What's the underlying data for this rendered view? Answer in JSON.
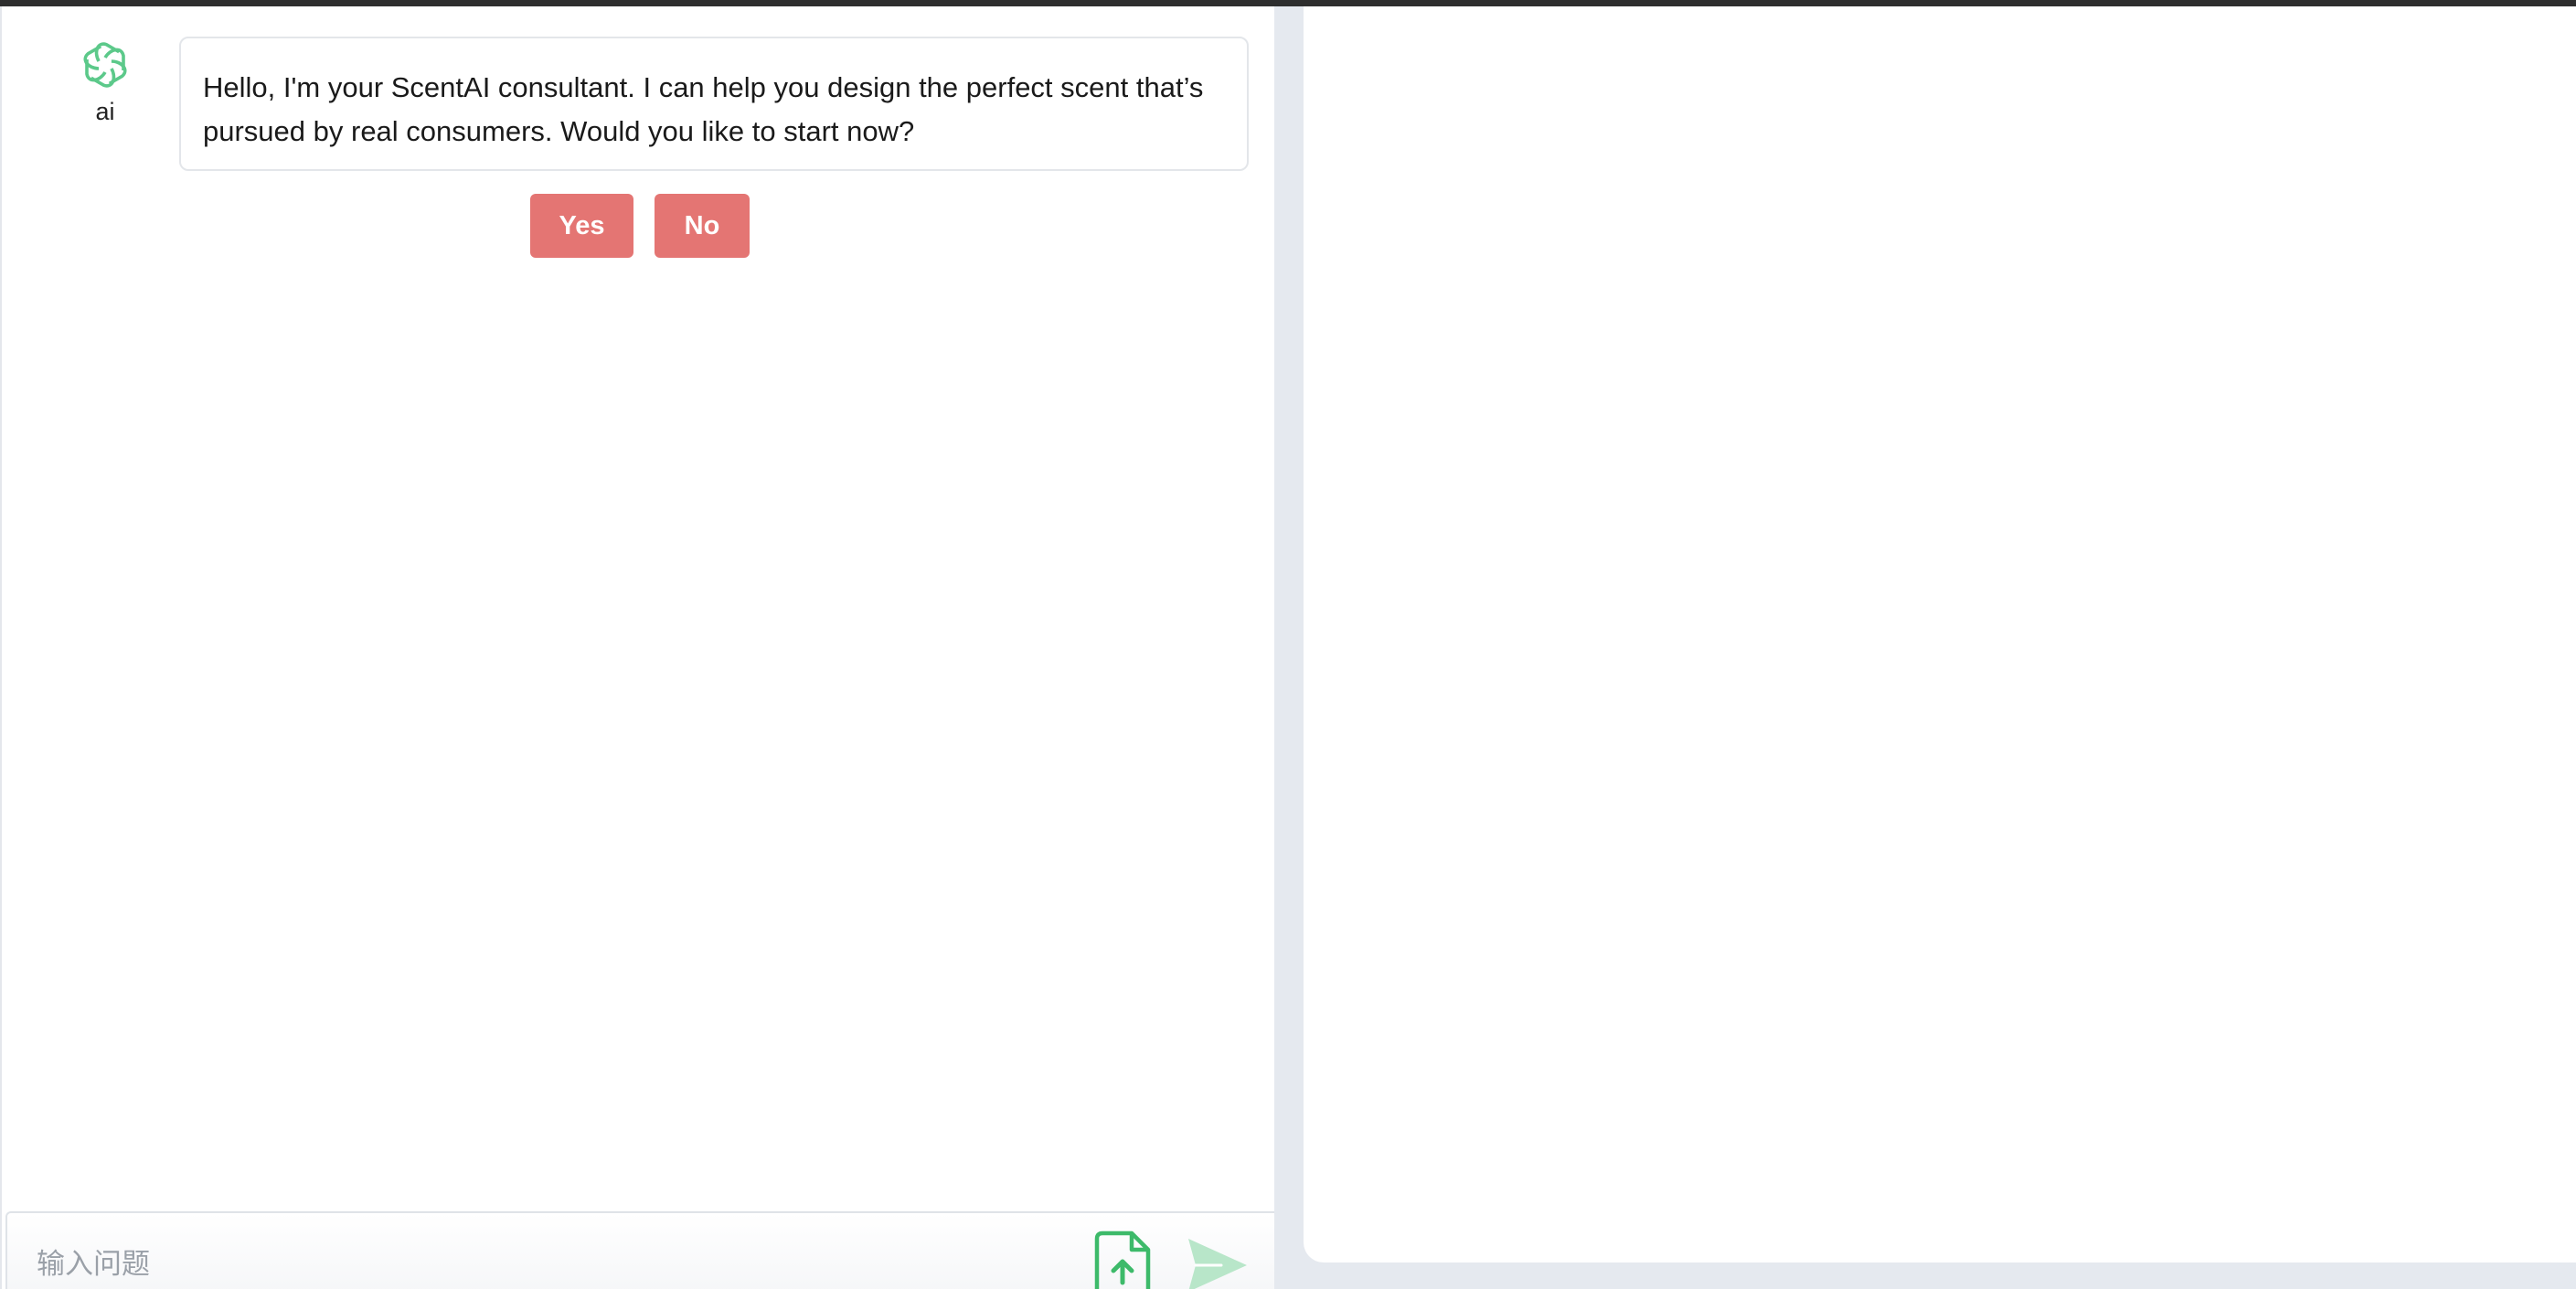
{
  "chat": {
    "messages": [
      {
        "role": "ai",
        "avatar_label": "ai",
        "avatar_icon": "openai-logo-icon",
        "text": "Hello, I'm your ScentAI consultant. I can help you design the perfect scent that’s pursued by real consumers. Would you like to start now?"
      }
    ],
    "choices": {
      "yes_label": "Yes",
      "no_label": "No"
    }
  },
  "input": {
    "placeholder": "输入问题",
    "value": ""
  },
  "icons": {
    "upload": "file-upload-icon",
    "send": "send-icon"
  },
  "colors": {
    "accent_green": "#3dba6a",
    "button_red": "#e47573",
    "send_disabled": "#b8e6c9"
  }
}
